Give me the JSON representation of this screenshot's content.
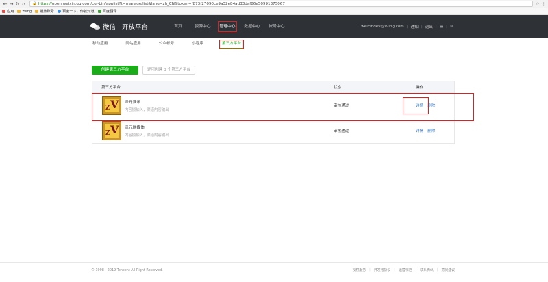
{
  "browser": {
    "url_scheme": "https://",
    "url_rest": "open.weixin.qq.com/cgi-bin/applist?t=manage/list&lang=zh_CN&token=f873f27090ce9a32e84ad33daf86e50991375067",
    "bookmarks": [
      "应用",
      "zving",
      "播放账号",
      "百度一下，你就知道",
      "百度翻译"
    ]
  },
  "header": {
    "brand": "微信 · 开放平台",
    "nav": [
      "首页",
      "资源中心",
      "管理中心",
      "数据中心",
      "帐号中心"
    ],
    "active_nav_index": 2,
    "account": "weixindev@zving.com",
    "notify": "通知",
    "logout": "退出"
  },
  "subnav": {
    "items": [
      "移动应用",
      "网站应用",
      "公众帐号",
      "小程序",
      "第三方平台"
    ],
    "active_index": 4
  },
  "actions": {
    "create_label": "创建第三方平台",
    "quota_label": "还可创建 3 个第三方平台"
  },
  "table": {
    "headers": {
      "name": "第三方平台",
      "status": "状态",
      "ops": "操作"
    },
    "rows": [
      {
        "title": "泽元演示",
        "desc": "内容摄抽入，渠道内容输出",
        "status": "审核通过",
        "detail": "详情",
        "delete": "删除"
      },
      {
        "title": "泽元融媒体",
        "desc": "内容摄抽入，渠道内容输出",
        "status": "审核通过",
        "detail": "详情",
        "delete": "删除"
      }
    ]
  },
  "footer": {
    "copyright": "© 1998 - 2019 Tencent All Right Reserved.",
    "links": [
      "授权服务",
      "开发者协议",
      "运营规范",
      "联系腾讯",
      "意见建议"
    ]
  },
  "colors": {
    "accent": "#1aad19",
    "topbar": "#2e3136",
    "highlight": "#e02020",
    "link": "#3b7cc4"
  }
}
